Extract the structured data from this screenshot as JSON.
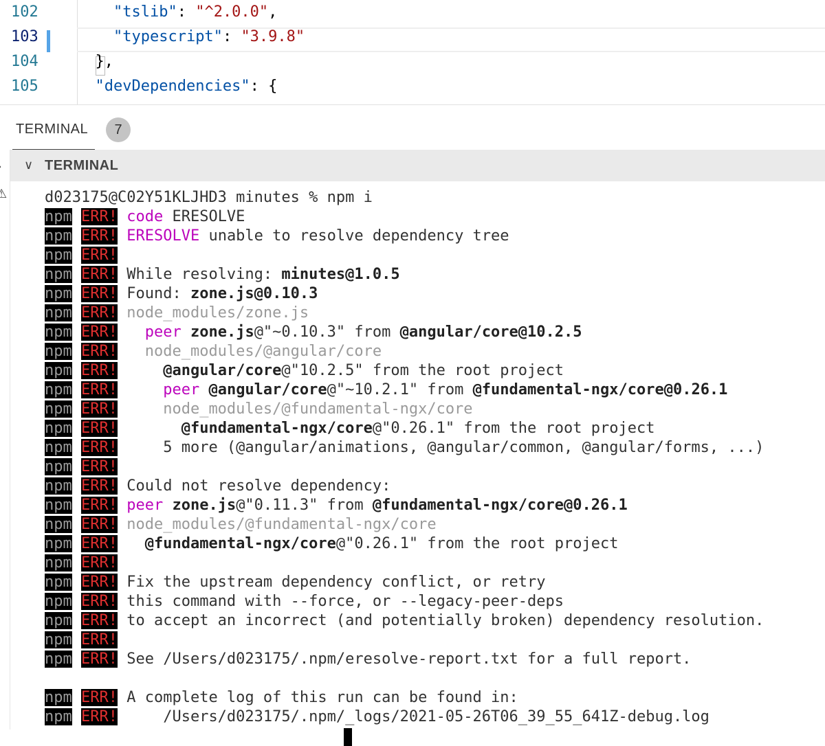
{
  "editor": {
    "lines": [
      {
        "num": "102",
        "indent": "    ",
        "key": "\"tslib\"",
        "sep": ": ",
        "value": "\"^2.0.0\"",
        "end": ","
      },
      {
        "num": "103",
        "indent": "    ",
        "key": "\"typescript\"",
        "sep": ": ",
        "value": "\"3.9.8\"",
        "end": ""
      },
      {
        "num": "104",
        "indent": "  ",
        "key": "",
        "sep": "",
        "value": "",
        "end": "},"
      },
      {
        "num": "105",
        "indent": "  ",
        "key": "\"devDependencies\"",
        "sep": ": ",
        "value": "",
        "end": "{"
      }
    ]
  },
  "panel": {
    "tab_label": "TERMINAL",
    "tab_badge": "7",
    "section_title": "TERMINAL",
    "chevron_icon": "chevron-down-icon"
  },
  "terminal": {
    "prompt": "d023175@C02Y51KLJHD3 minutes % npm i",
    "prefix_npm": "npm",
    "prefix_err": "ERR!",
    "lines": [
      [
        {
          "t": "code",
          "c": "kw"
        },
        {
          "t": " ERESOLVE",
          "c": ""
        }
      ],
      [
        {
          "t": "ERESOLVE",
          "c": "kw"
        },
        {
          "t": " unable to resolve dependency tree",
          "c": ""
        }
      ],
      [],
      [
        {
          "t": "While resolving: ",
          "c": ""
        },
        {
          "t": "minutes@1.0.5",
          "c": "b"
        }
      ],
      [
        {
          "t": "Found: ",
          "c": ""
        },
        {
          "t": "zone.js@0.10.3",
          "c": "b"
        }
      ],
      [
        {
          "t": "node_modules/zone.js",
          "c": "dim"
        }
      ],
      [
        {
          "t": "  ",
          "c": ""
        },
        {
          "t": "peer",
          "c": "kw"
        },
        {
          "t": " ",
          "c": ""
        },
        {
          "t": "zone.js",
          "c": "b"
        },
        {
          "t": "@\"~0.10.3\" from ",
          "c": ""
        },
        {
          "t": "@angular/core@10.2.5",
          "c": "b"
        }
      ],
      [
        {
          "t": "  node_modules/@angular/core",
          "c": "dim"
        }
      ],
      [
        {
          "t": "    ",
          "c": ""
        },
        {
          "t": "@angular/core",
          "c": "b"
        },
        {
          "t": "@\"10.2.5\" from the root project",
          "c": ""
        }
      ],
      [
        {
          "t": "    ",
          "c": ""
        },
        {
          "t": "peer",
          "c": "kw"
        },
        {
          "t": " ",
          "c": ""
        },
        {
          "t": "@angular/core",
          "c": "b"
        },
        {
          "t": "@\"~10.2.1\" from ",
          "c": ""
        },
        {
          "t": "@fundamental-ngx/core@0.26.1",
          "c": "b"
        }
      ],
      [
        {
          "t": "    node_modules/@fundamental-ngx/core",
          "c": "dim"
        }
      ],
      [
        {
          "t": "      ",
          "c": ""
        },
        {
          "t": "@fundamental-ngx/core",
          "c": "b"
        },
        {
          "t": "@\"0.26.1\" from the root project",
          "c": ""
        }
      ],
      [
        {
          "t": "    5 more (@angular/animations, @angular/common, @angular/forms, ...)",
          "c": ""
        }
      ],
      [],
      [
        {
          "t": "Could not resolve dependency:",
          "c": ""
        }
      ],
      [
        {
          "t": "peer",
          "c": "kw"
        },
        {
          "t": " ",
          "c": ""
        },
        {
          "t": "zone.js",
          "c": "b"
        },
        {
          "t": "@\"0.11.3\" from ",
          "c": ""
        },
        {
          "t": "@fundamental-ngx/core@0.26.1",
          "c": "b"
        }
      ],
      [
        {
          "t": "node_modules/@fundamental-ngx/core",
          "c": "dim"
        }
      ],
      [
        {
          "t": "  ",
          "c": ""
        },
        {
          "t": "@fundamental-ngx/core",
          "c": "b"
        },
        {
          "t": "@\"0.26.1\" from the root project",
          "c": ""
        }
      ],
      [],
      [
        {
          "t": "Fix the upstream dependency conflict, or retry",
          "c": ""
        }
      ],
      [
        {
          "t": "this command with --force, or --legacy-peer-deps",
          "c": ""
        }
      ],
      [
        {
          "t": "to accept an incorrect (and potentially broken) dependency resolution.",
          "c": ""
        }
      ],
      [],
      [
        {
          "t": "See /Users/d023175/.npm/eresolve-report.txt for a full report.",
          "c": ""
        }
      ]
    ],
    "log_lines": [
      [
        {
          "t": "A complete log of this run can be found in:",
          "c": ""
        }
      ],
      [
        {
          "t": "    /Users/d023175/.npm/_logs/2021-05-26T06_39_55_641Z-debug.log",
          "c": ""
        }
      ]
    ]
  }
}
